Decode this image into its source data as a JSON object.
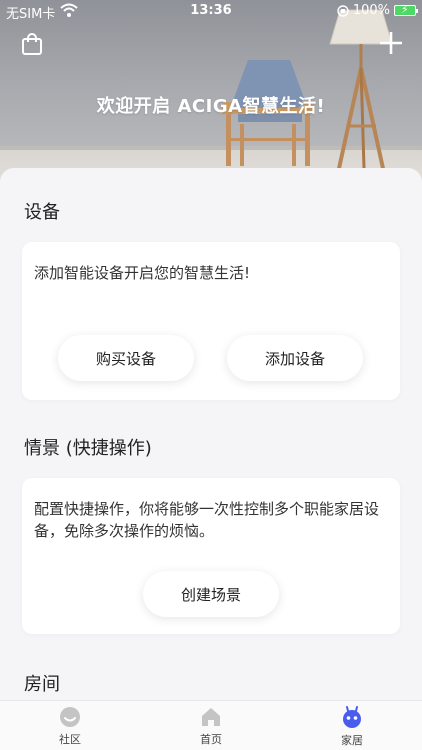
{
  "status_bar": {
    "carrier": "无SIM卡",
    "time": "13:36",
    "battery": "100%"
  },
  "header": {
    "title": "欢迎开启 ACIGA智慧生活!"
  },
  "devices": {
    "section_title": "设备",
    "description": "添加智能设备开启您的智慧生活!",
    "buy_button": "购买设备",
    "add_button": "添加设备"
  },
  "scenes": {
    "section_title": "情景 (快捷操作)",
    "description": "配置快捷操作，你将能够一次性控制多个职能家居设备，免除多次操作的烦恼。",
    "create_button": "创建场景"
  },
  "rooms": {
    "section_title": "房间"
  },
  "tabbar": {
    "tabs": [
      {
        "label": "社区",
        "icon": "smiley-icon",
        "active": false
      },
      {
        "label": "首页",
        "icon": "home-icon",
        "active": false
      },
      {
        "label": "家居",
        "icon": "robot-icon",
        "active": true
      }
    ]
  },
  "colors": {
    "accent": "#4a5cf0",
    "tab_icon": "#c4c4c4"
  }
}
